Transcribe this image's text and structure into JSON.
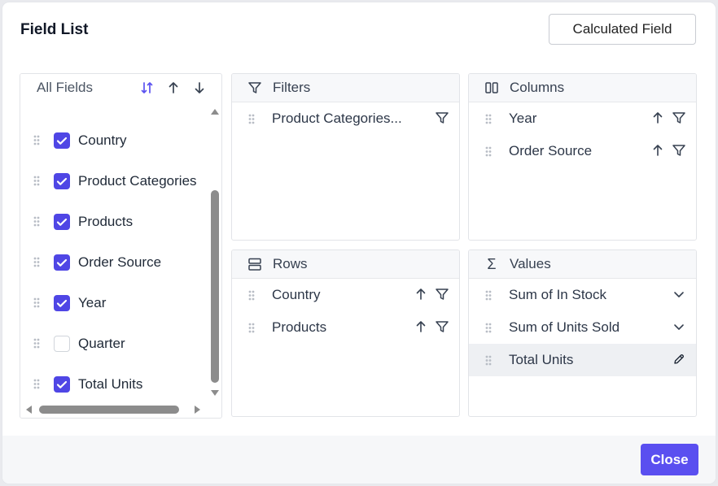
{
  "dialog": {
    "title": "Field List",
    "calculated_field_label": "Calculated Field",
    "close_label": "Close"
  },
  "all_fields": {
    "title": "All Fields",
    "items": [
      {
        "label": "Country",
        "checked": true
      },
      {
        "label": "Product Categories",
        "checked": true
      },
      {
        "label": "Products",
        "checked": true
      },
      {
        "label": "Order Source",
        "checked": true
      },
      {
        "label": "Year",
        "checked": true
      },
      {
        "label": "Quarter",
        "checked": false
      },
      {
        "label": "Total Units",
        "checked": true
      }
    ]
  },
  "filters": {
    "title": "Filters",
    "items": [
      {
        "label": "Product Categories..."
      }
    ]
  },
  "columns": {
    "title": "Columns",
    "items": [
      {
        "label": "Year"
      },
      {
        "label": "Order Source"
      }
    ]
  },
  "rows": {
    "title": "Rows",
    "items": [
      {
        "label": "Country"
      },
      {
        "label": "Products"
      }
    ]
  },
  "values": {
    "title": "Values",
    "items": [
      {
        "label": "Sum of In Stock"
      },
      {
        "label": "Sum of Units Sold"
      },
      {
        "label": "Total Units"
      }
    ]
  },
  "colors": {
    "accent": "#4f46e5",
    "close_button": "#5a4ff0",
    "scroll_thumb": "#8c8c8c"
  }
}
